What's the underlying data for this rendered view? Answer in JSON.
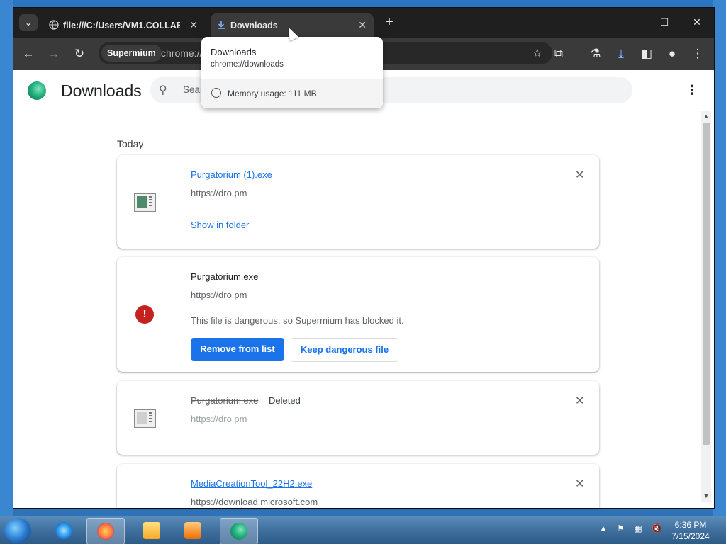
{
  "browser": {
    "tabs": [
      {
        "title": "file:///C:/Users/VM1.COLLABN",
        "active": false
      },
      {
        "title": "Downloads",
        "active": true
      }
    ],
    "new_tab": "+",
    "window_controls": {
      "minimize": "—",
      "maximize": "☐",
      "close": "✕"
    },
    "omnibox": {
      "chip": "Supermium",
      "url": "chrome://"
    }
  },
  "tooltip": {
    "title": "Downloads",
    "url": "chrome://downloads",
    "memory": "Memory usage: 111 MB"
  },
  "page": {
    "title": "Downloads",
    "search_placeholder": "Search downloads",
    "section": "Today",
    "downloads": [
      {
        "name": "Purgatorium (1).exe",
        "url": "https://dro.pm",
        "action": "Show in folder"
      },
      {
        "name": "Purgatorium.exe",
        "url": "https://dro.pm",
        "warning": "This file is dangerous, so Supermium has blocked it.",
        "primary": "Remove from list",
        "secondary": "Keep dangerous file"
      },
      {
        "name": "Purgatorium.exe",
        "status": "Deleted",
        "url": "https://dro.pm"
      },
      {
        "name": "MediaCreationTool_22H2.exe",
        "url": "https://download.microsoft.com"
      }
    ]
  },
  "taskbar": {
    "time": "6:36 PM",
    "date": "7/15/2024"
  },
  "colors": {
    "accent": "#1a73e8",
    "danger": "#c5221f"
  }
}
